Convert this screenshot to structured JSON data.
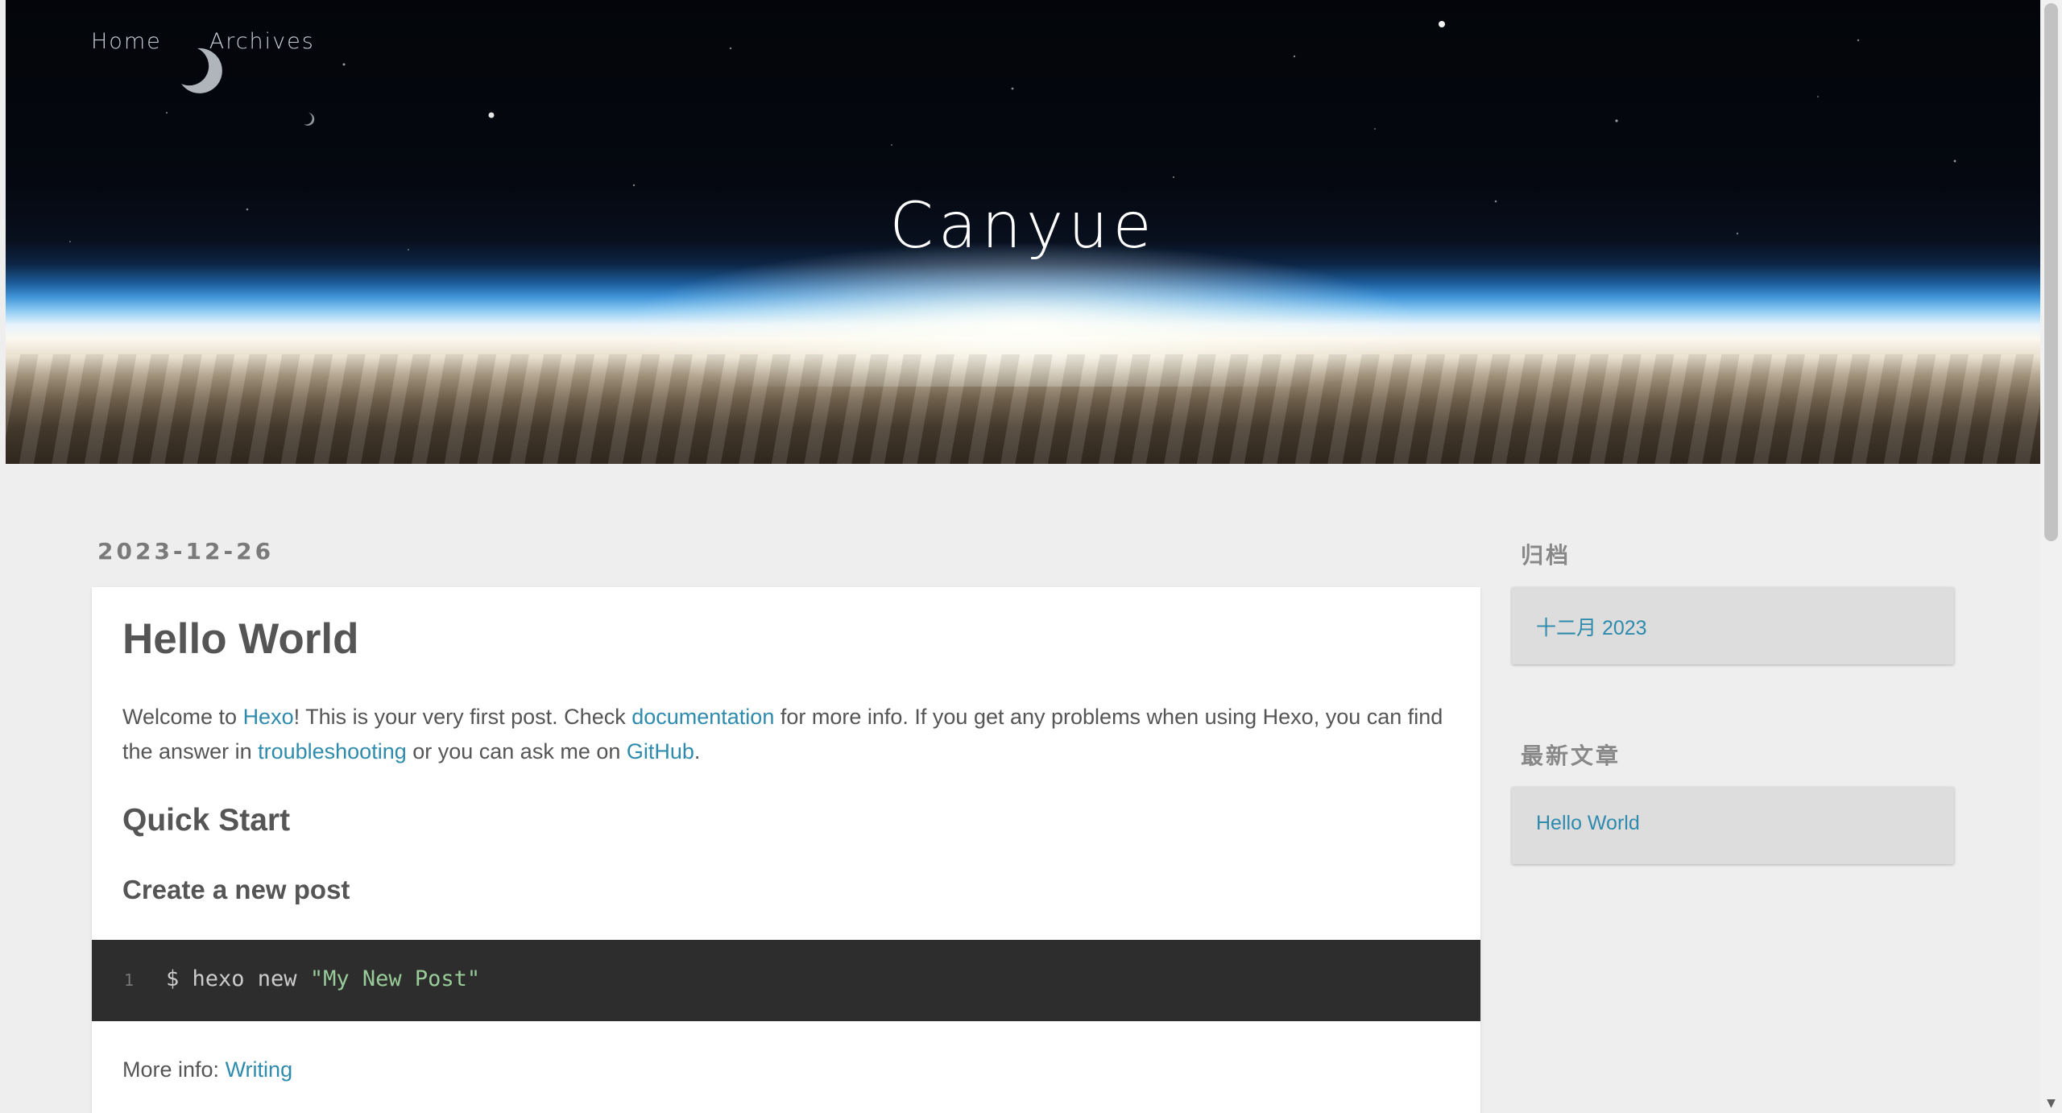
{
  "nav": {
    "items": [
      "Home",
      "Archives"
    ]
  },
  "site": {
    "title": "Canyue"
  },
  "post": {
    "date": "2023-12-26",
    "title": "Hello World",
    "intro": {
      "t1": "Welcome to ",
      "link_hexo": "Hexo",
      "t2": "! This is your very first post. Check ",
      "link_docs": "documentation",
      "t3": " for more info. If you get any problems when using Hexo, you can find the answer in ",
      "link_trouble": "troubleshooting",
      "t4": " or you can ask me on ",
      "link_github": "GitHub",
      "t5": "."
    },
    "h_quick_start": "Quick Start",
    "h_create_post": "Create a new post",
    "code": {
      "line_no": "1",
      "command": "$ hexo new ",
      "string": "\"My New Post\""
    },
    "more_info": {
      "label": "More info: ",
      "link": "Writing"
    }
  },
  "sidebar": {
    "archives_heading": "归档",
    "archives_item": "十二月 2023",
    "recent_heading": "最新文章",
    "recent_item": "Hello World"
  },
  "colors": {
    "link": "#2e8bad",
    "background": "#eeeeee",
    "code_bg": "#2d2d2d"
  }
}
